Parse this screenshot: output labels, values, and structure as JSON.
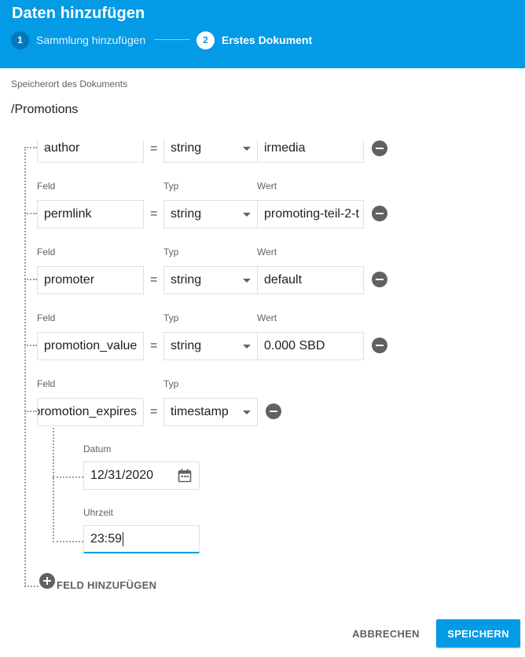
{
  "dialog": {
    "title": "Daten hinzufügen",
    "steps": [
      {
        "number": "1",
        "label": "Sammlung hinzufügen",
        "active": false
      },
      {
        "number": "2",
        "label": "Erstes Dokument",
        "active": true
      }
    ]
  },
  "location": {
    "label": "Speicherort des Dokuments",
    "path": "/Promotions"
  },
  "column_labels": {
    "field": "Feld",
    "type": "Typ",
    "value": "Wert"
  },
  "equals_sign": "=",
  "fields": [
    {
      "name": "author",
      "type": "string",
      "value": "irmedia"
    },
    {
      "name": "permlink",
      "type": "string",
      "value": "promoting-teil-2-t"
    },
    {
      "name": "promoter",
      "type": "string",
      "value": "default"
    },
    {
      "name": "promotion_value",
      "type": "string",
      "value": "0.000 SBD"
    },
    {
      "name": "promotion_expires",
      "type": "timestamp"
    }
  ],
  "timestamp": {
    "date_label": "Datum",
    "date_value": "12/31/2020",
    "time_label": "Uhrzeit",
    "time_value": "23:59"
  },
  "add_field_label": "FELD HINZUFÜGEN",
  "buttons": {
    "cancel": "ABBRECHEN",
    "save": "SPEICHERN"
  },
  "colors": {
    "primary": "#039be5",
    "icon_gray": "#616161"
  }
}
